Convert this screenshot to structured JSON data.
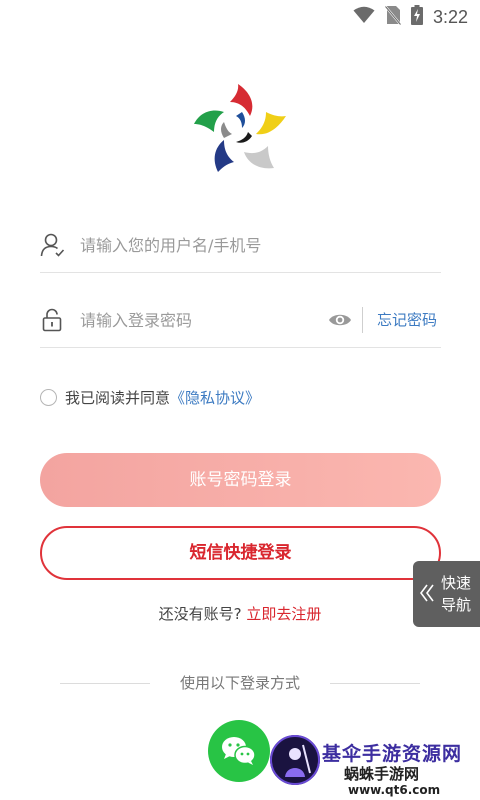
{
  "status_bar": {
    "time": "3:22",
    "icons": [
      "wifi-icon",
      "no-sim-icon",
      "battery-charging-icon"
    ]
  },
  "logo": {
    "icon": "pinwheel-logo"
  },
  "login_form": {
    "username_placeholder": "请输入您的用户名/手机号",
    "password_placeholder": "请输入登录密码",
    "forgot_password": "忘记密码",
    "agreement_prefix": "我已阅读并同意",
    "agreement_link": "《隐私协议》"
  },
  "buttons": {
    "password_login": "账号密码登录",
    "sms_login": "短信快捷登录"
  },
  "register": {
    "question": "还没有账号?",
    "link": "立即去注册"
  },
  "quick_nav": {
    "label_line1": "快速",
    "label_line2": "导航"
  },
  "other_login": {
    "divider_text": "使用以下登录方式",
    "methods": [
      "wechat-icon"
    ]
  },
  "watermark": {
    "title": "基伞手游资源网",
    "subtitle": "蜗蛛手游网",
    "url": "www.qt6.com"
  },
  "colors": {
    "accent_red": "#d9262e",
    "link_blue": "#3d7bc2",
    "login_button_bg": "#f5a8a3",
    "wechat_green": "#28c445"
  }
}
